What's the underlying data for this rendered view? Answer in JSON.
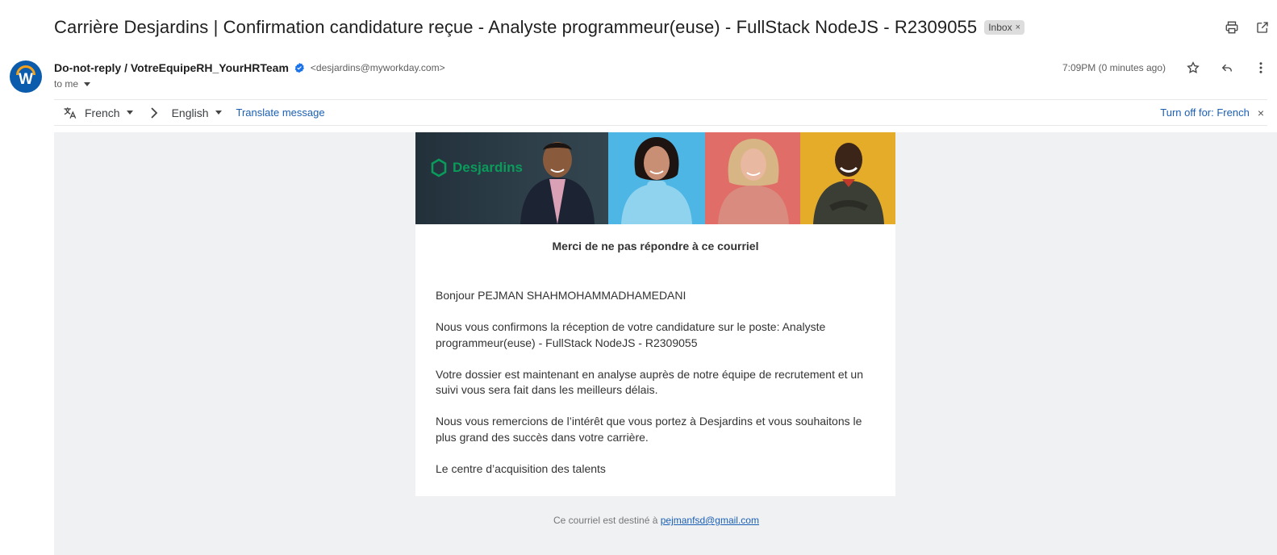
{
  "email": {
    "subject": "Carrière Desjardins | Confirmation candidature reçue - Analyste programmeur(euse) - FullStack NodeJS - R2309055",
    "label": "Inbox",
    "label_remove": "×",
    "sender_name": "Do-not-reply / VotreEquipeRH_YourHRTeam",
    "sender_email": "<desjardins@myworkday.com>",
    "to": "to me",
    "timestamp": "7:09PM (0 minutes ago)",
    "avatar_letter": "W"
  },
  "translate": {
    "source_lang": "French",
    "target_lang": "English",
    "translate_link": "Translate message",
    "turn_off": "Turn off for: French",
    "close": "×"
  },
  "banner": {
    "brand": "Desjardins"
  },
  "message": {
    "title": "Merci de ne pas répondre à ce courriel",
    "greeting": "Bonjour PEJMAN SHAHMOHAMMADHAMEDANI",
    "para1": "Nous vous confirmons la réception de votre candidature sur le poste: Analyste programmeur(euse) - FullStack NodeJS - R2309055",
    "para2": "Votre dossier est maintenant en analyse auprès de notre équipe de recrutement et un suivi vous sera fait dans les meilleurs délais.",
    "para3": "Nous vous remercions de l’intérêt que vous portez à Desjardins et vous souhaitons le plus grand des succès dans votre carrière.",
    "signature": "Le centre d’acquisition des talents"
  },
  "footer": {
    "prefix": "Ce courriel est destiné à",
    "recipient": "pejmanfsd@gmail.com"
  },
  "colors": {
    "brand_green": "#0a9b5b",
    "link_blue": "#1a5fb4",
    "avatar_blue": "#0b5cad"
  },
  "icons": [
    "print-icon",
    "open-new-window-icon",
    "verified-icon",
    "star-icon",
    "reply-icon",
    "more-vert-icon",
    "translate-icon",
    "chevron-right-icon"
  ]
}
